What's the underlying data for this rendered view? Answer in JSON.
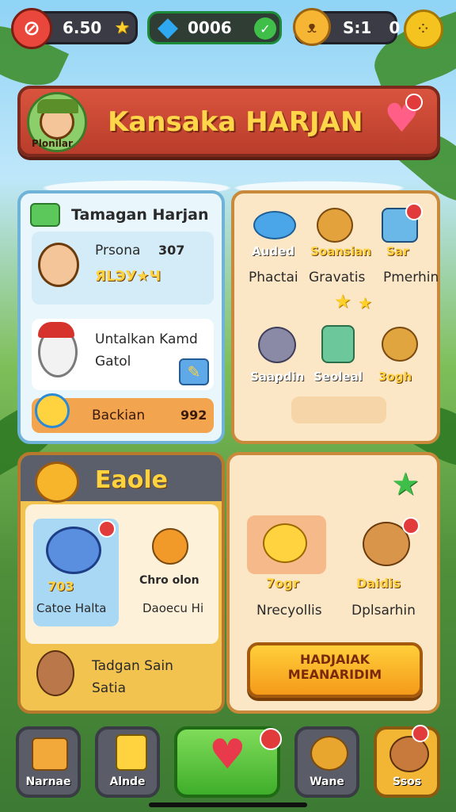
{
  "topbar": {
    "coins": "6.50",
    "gems": "0006",
    "pets_value": "S:1",
    "pets_count": "0"
  },
  "banner": {
    "title": "Kansaka HARJAN",
    "avatar_label": "Plonilar"
  },
  "left_card": {
    "header": "Tamagan Harjan",
    "row1": {
      "name": "Prsona",
      "value": "307",
      "sub": "ЯLЭУ★Ч"
    },
    "row2": {
      "line1": "Untalkan Kamd",
      "line2": "Gatol"
    },
    "row3": {
      "label": "Backian",
      "value": "992"
    }
  },
  "right_card": {
    "items": [
      {
        "title": "Auded",
        "label": "Phactai"
      },
      {
        "title": "Soansian",
        "label": "Gravatis"
      },
      {
        "title": "Sar",
        "label": "Pmerhin"
      },
      {
        "title": "Saapdin",
        "label": ""
      },
      {
        "title": "Seoleal",
        "label": ""
      },
      {
        "title": "3ogh",
        "label": ""
      }
    ]
  },
  "event_card": {
    "title": "Eaole",
    "pets": [
      {
        "stars": "703",
        "label": "Catoe Halta"
      },
      {
        "title": "Chro olon",
        "label": "Daoecu Hi"
      }
    ],
    "footer_line1": "Tadgan Sain",
    "footer_line2": "Satia"
  },
  "shop_card": {
    "items": [
      {
        "title": "7ogr",
        "label": "Nrecyollis"
      },
      {
        "title": "Daidis",
        "label": "Dplsarhin"
      }
    ],
    "button_line1": "HADJAIAK",
    "button_line2": "MEANARIDIM"
  },
  "nav": {
    "items": [
      "Narnae",
      "Alnde",
      "",
      "Wane",
      "Ssos"
    ]
  }
}
